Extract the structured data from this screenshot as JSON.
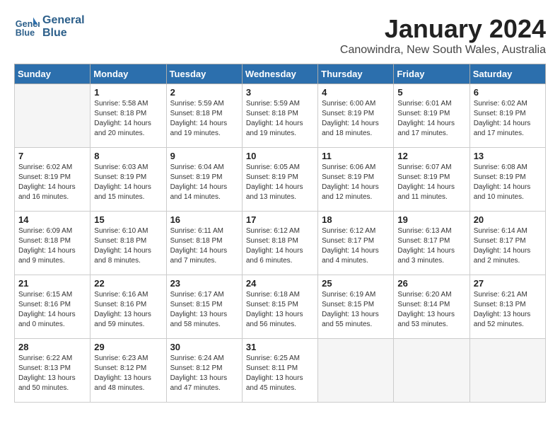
{
  "logo": {
    "line1": "General",
    "line2": "Blue"
  },
  "title": "January 2024",
  "location": "Canowindra, New South Wales, Australia",
  "weekdays": [
    "Sunday",
    "Monday",
    "Tuesday",
    "Wednesday",
    "Thursday",
    "Friday",
    "Saturday"
  ],
  "weeks": [
    [
      {
        "day": "",
        "info": ""
      },
      {
        "day": "1",
        "info": "Sunrise: 5:58 AM\nSunset: 8:18 PM\nDaylight: 14 hours\nand 20 minutes."
      },
      {
        "day": "2",
        "info": "Sunrise: 5:59 AM\nSunset: 8:18 PM\nDaylight: 14 hours\nand 19 minutes."
      },
      {
        "day": "3",
        "info": "Sunrise: 5:59 AM\nSunset: 8:18 PM\nDaylight: 14 hours\nand 19 minutes."
      },
      {
        "day": "4",
        "info": "Sunrise: 6:00 AM\nSunset: 8:19 PM\nDaylight: 14 hours\nand 18 minutes."
      },
      {
        "day": "5",
        "info": "Sunrise: 6:01 AM\nSunset: 8:19 PM\nDaylight: 14 hours\nand 17 minutes."
      },
      {
        "day": "6",
        "info": "Sunrise: 6:02 AM\nSunset: 8:19 PM\nDaylight: 14 hours\nand 17 minutes."
      }
    ],
    [
      {
        "day": "7",
        "info": "Sunrise: 6:02 AM\nSunset: 8:19 PM\nDaylight: 14 hours\nand 16 minutes."
      },
      {
        "day": "8",
        "info": "Sunrise: 6:03 AM\nSunset: 8:19 PM\nDaylight: 14 hours\nand 15 minutes."
      },
      {
        "day": "9",
        "info": "Sunrise: 6:04 AM\nSunset: 8:19 PM\nDaylight: 14 hours\nand 14 minutes."
      },
      {
        "day": "10",
        "info": "Sunrise: 6:05 AM\nSunset: 8:19 PM\nDaylight: 14 hours\nand 13 minutes."
      },
      {
        "day": "11",
        "info": "Sunrise: 6:06 AM\nSunset: 8:19 PM\nDaylight: 14 hours\nand 12 minutes."
      },
      {
        "day": "12",
        "info": "Sunrise: 6:07 AM\nSunset: 8:19 PM\nDaylight: 14 hours\nand 11 minutes."
      },
      {
        "day": "13",
        "info": "Sunrise: 6:08 AM\nSunset: 8:19 PM\nDaylight: 14 hours\nand 10 minutes."
      }
    ],
    [
      {
        "day": "14",
        "info": "Sunrise: 6:09 AM\nSunset: 8:18 PM\nDaylight: 14 hours\nand 9 minutes."
      },
      {
        "day": "15",
        "info": "Sunrise: 6:10 AM\nSunset: 8:18 PM\nDaylight: 14 hours\nand 8 minutes."
      },
      {
        "day": "16",
        "info": "Sunrise: 6:11 AM\nSunset: 8:18 PM\nDaylight: 14 hours\nand 7 minutes."
      },
      {
        "day": "17",
        "info": "Sunrise: 6:12 AM\nSunset: 8:18 PM\nDaylight: 14 hours\nand 6 minutes."
      },
      {
        "day": "18",
        "info": "Sunrise: 6:12 AM\nSunset: 8:17 PM\nDaylight: 14 hours\nand 4 minutes."
      },
      {
        "day": "19",
        "info": "Sunrise: 6:13 AM\nSunset: 8:17 PM\nDaylight: 14 hours\nand 3 minutes."
      },
      {
        "day": "20",
        "info": "Sunrise: 6:14 AM\nSunset: 8:17 PM\nDaylight: 14 hours\nand 2 minutes."
      }
    ],
    [
      {
        "day": "21",
        "info": "Sunrise: 6:15 AM\nSunset: 8:16 PM\nDaylight: 14 hours\nand 0 minutes."
      },
      {
        "day": "22",
        "info": "Sunrise: 6:16 AM\nSunset: 8:16 PM\nDaylight: 13 hours\nand 59 minutes."
      },
      {
        "day": "23",
        "info": "Sunrise: 6:17 AM\nSunset: 8:15 PM\nDaylight: 13 hours\nand 58 minutes."
      },
      {
        "day": "24",
        "info": "Sunrise: 6:18 AM\nSunset: 8:15 PM\nDaylight: 13 hours\nand 56 minutes."
      },
      {
        "day": "25",
        "info": "Sunrise: 6:19 AM\nSunset: 8:15 PM\nDaylight: 13 hours\nand 55 minutes."
      },
      {
        "day": "26",
        "info": "Sunrise: 6:20 AM\nSunset: 8:14 PM\nDaylight: 13 hours\nand 53 minutes."
      },
      {
        "day": "27",
        "info": "Sunrise: 6:21 AM\nSunset: 8:13 PM\nDaylight: 13 hours\nand 52 minutes."
      }
    ],
    [
      {
        "day": "28",
        "info": "Sunrise: 6:22 AM\nSunset: 8:13 PM\nDaylight: 13 hours\nand 50 minutes."
      },
      {
        "day": "29",
        "info": "Sunrise: 6:23 AM\nSunset: 8:12 PM\nDaylight: 13 hours\nand 48 minutes."
      },
      {
        "day": "30",
        "info": "Sunrise: 6:24 AM\nSunset: 8:12 PM\nDaylight: 13 hours\nand 47 minutes."
      },
      {
        "day": "31",
        "info": "Sunrise: 6:25 AM\nSunset: 8:11 PM\nDaylight: 13 hours\nand 45 minutes."
      },
      {
        "day": "",
        "info": ""
      },
      {
        "day": "",
        "info": ""
      },
      {
        "day": "",
        "info": ""
      }
    ]
  ]
}
